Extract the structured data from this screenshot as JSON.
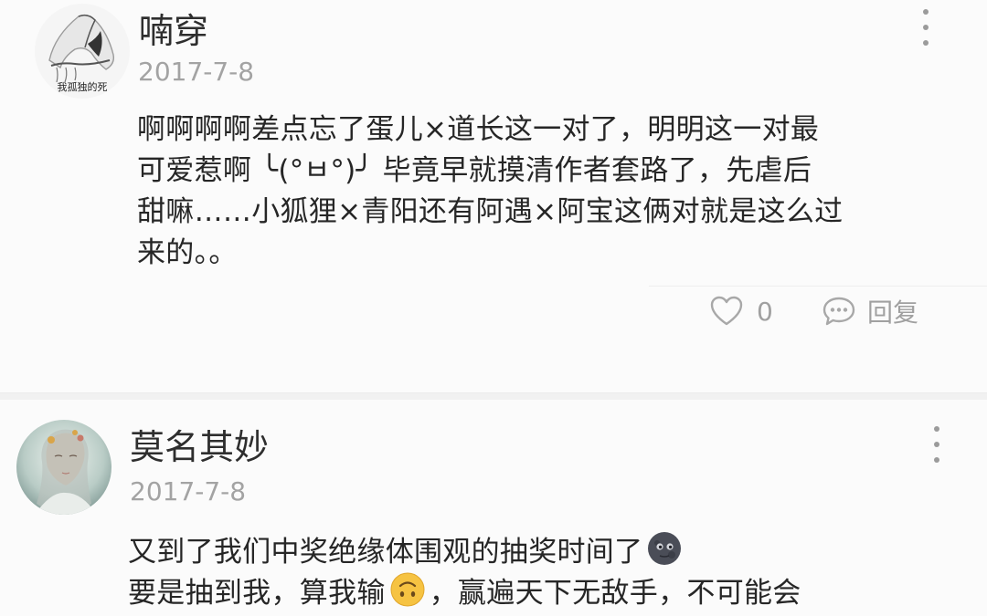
{
  "comments": [
    {
      "username": "喃穿",
      "date": "2017-7-8",
      "avatar_text": "我孤独的死",
      "content_lines": [
        "啊啊啊啊差点忘了蛋儿×道长这一对了，明明这一对最",
        "可爱惹啊 ╰(°ㅂ°)╯ 毕竟早就摸清作者套路了，先虐后",
        "甜嘛……小狐狸×青阳还有阿遇×阿宝这俩对就是这么过",
        "来的。。"
      ],
      "like_count": "0",
      "reply_label": "回复",
      "icons": {
        "like": "heart-outline-icon",
        "reply": "speech-bubble-icon",
        "more": "vertical-dots-icon"
      }
    },
    {
      "username": "莫名其妙",
      "date": "2017-7-8",
      "content_line_1": "又到了我们中奖绝缘体围观的抽奖时间了",
      "content_line_2_a": "要是抽到我，算我输",
      "content_line_2_b": "，赢遍天下无敌手，不可能会",
      "emojis": [
        "new-moon-face-emoji",
        "upside-down-face-emoji"
      ],
      "icons": {
        "more": "vertical-dots-icon"
      }
    }
  ],
  "colors": {
    "username": "#2e2e2e",
    "date": "#a3a3a3",
    "content": "#262626",
    "action": "#a0a0a0",
    "background": "#fbfbfb",
    "separator": "#f1f1f1"
  }
}
